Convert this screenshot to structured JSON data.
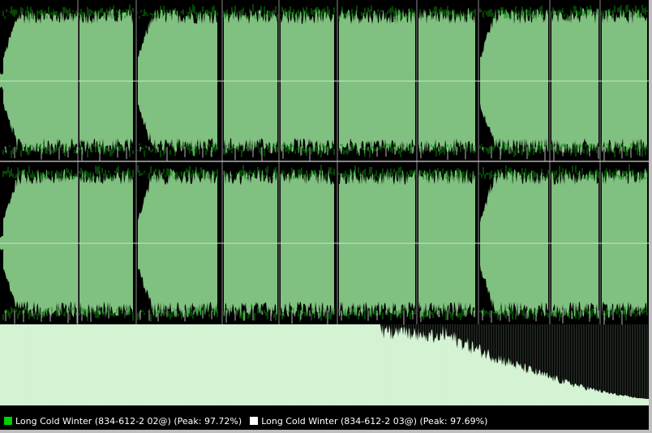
{
  "colors": {
    "background": "#000000",
    "wave_fill": "#80c080",
    "wave_peak": "#0a8a0a",
    "wave_peak_alt": "#b8b8b8",
    "spectrum": "#d6f5d6",
    "divider": "#b0b0b0",
    "legend_text": "#ffffff"
  },
  "tracks": [
    {
      "label": "Long Cold Winter (834-612-2 02@) (Peak: 97.72%)",
      "swatch_color": "#00d000"
    },
    {
      "label": "Long Cold Winter (834-612-2 03@) (Peak: 97.69%)",
      "swatch_color": "#ffffff"
    }
  ]
}
